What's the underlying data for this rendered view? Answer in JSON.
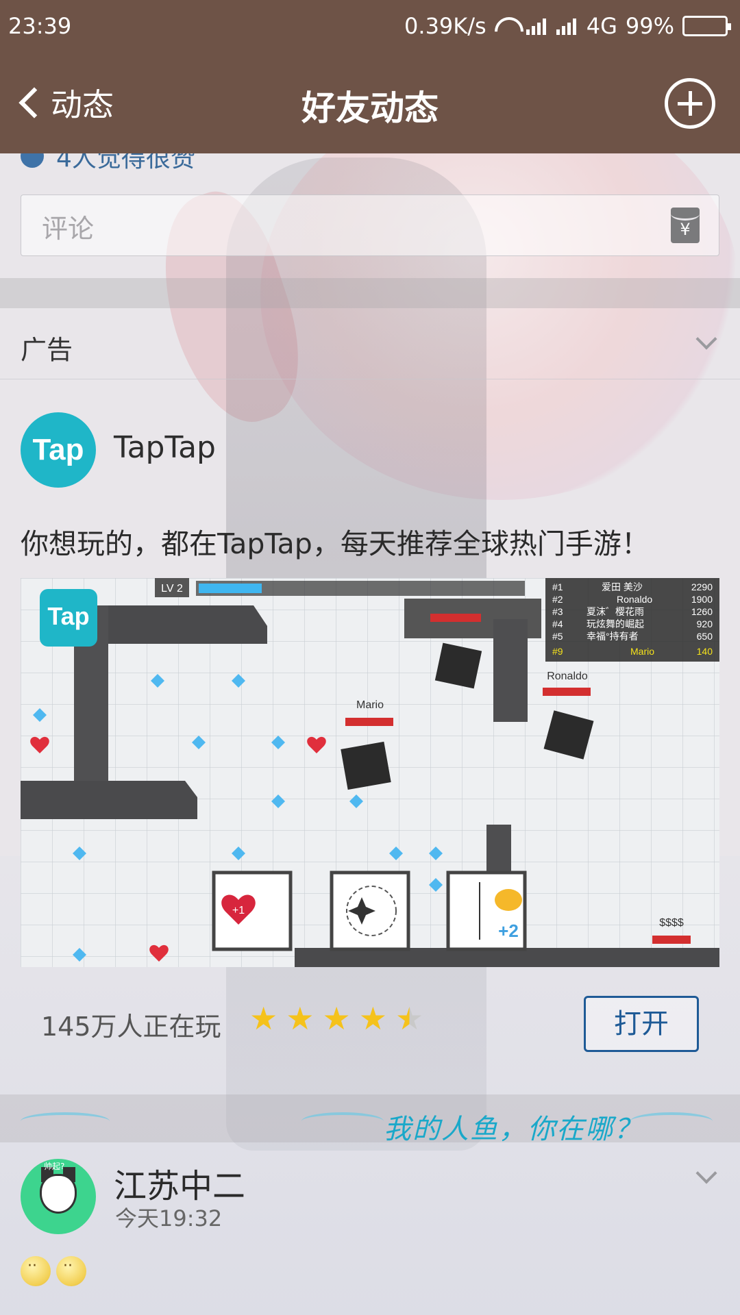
{
  "status_bar": {
    "time": "23:39",
    "net_speed": "0.39K/s",
    "network": "4G",
    "battery": "99%"
  },
  "nav": {
    "back_label": "动态",
    "title": "好友动态"
  },
  "post_top": {
    "likes_partial": "4人觉得很赞",
    "comment_placeholder": "评论",
    "redpacket_symbol": "¥"
  },
  "ad": {
    "label": "广告",
    "app_name": "TapTap",
    "avatar_text": "Tap",
    "text": "你想玩的，都在TapTap，每天推荐全球热门手游！",
    "players": "145万人正在玩",
    "rating": 4.5,
    "open_button": "打开",
    "image": {
      "logo_text": "Tap",
      "level": "LV 2",
      "leaderboard": [
        {
          "rank": "#1",
          "name": "爱田 美沙",
          "score": "2290"
        },
        {
          "rank": "#2",
          "name": "Ronaldo",
          "score": "1900"
        },
        {
          "rank": "#3",
          "name": "夏沫゛樱花雨",
          "score": "1260"
        },
        {
          "rank": "#4",
          "name": "玩炫舞的崛起",
          "score": "920"
        },
        {
          "rank": "#5",
          "name": "幸福°持有者",
          "score": "650"
        },
        {
          "rank": "#9",
          "name": "Mario",
          "score": "140"
        }
      ],
      "player_mario": "Mario",
      "player_ronaldo": "Ronaldo",
      "heart_badge": "+1",
      "plus_badge": "+2",
      "money": "$$$$"
    }
  },
  "banner_text": "我的人鱼，你在哪？",
  "next_post": {
    "user_name": "江苏中二",
    "time": "今天19:32",
    "avatar_caption": "帅起?"
  },
  "colors": {
    "header_bg": "#6e5347",
    "link_blue": "#1e5a96",
    "tap_teal": "#1fb6c8",
    "star_yellow": "#f5c21b"
  }
}
